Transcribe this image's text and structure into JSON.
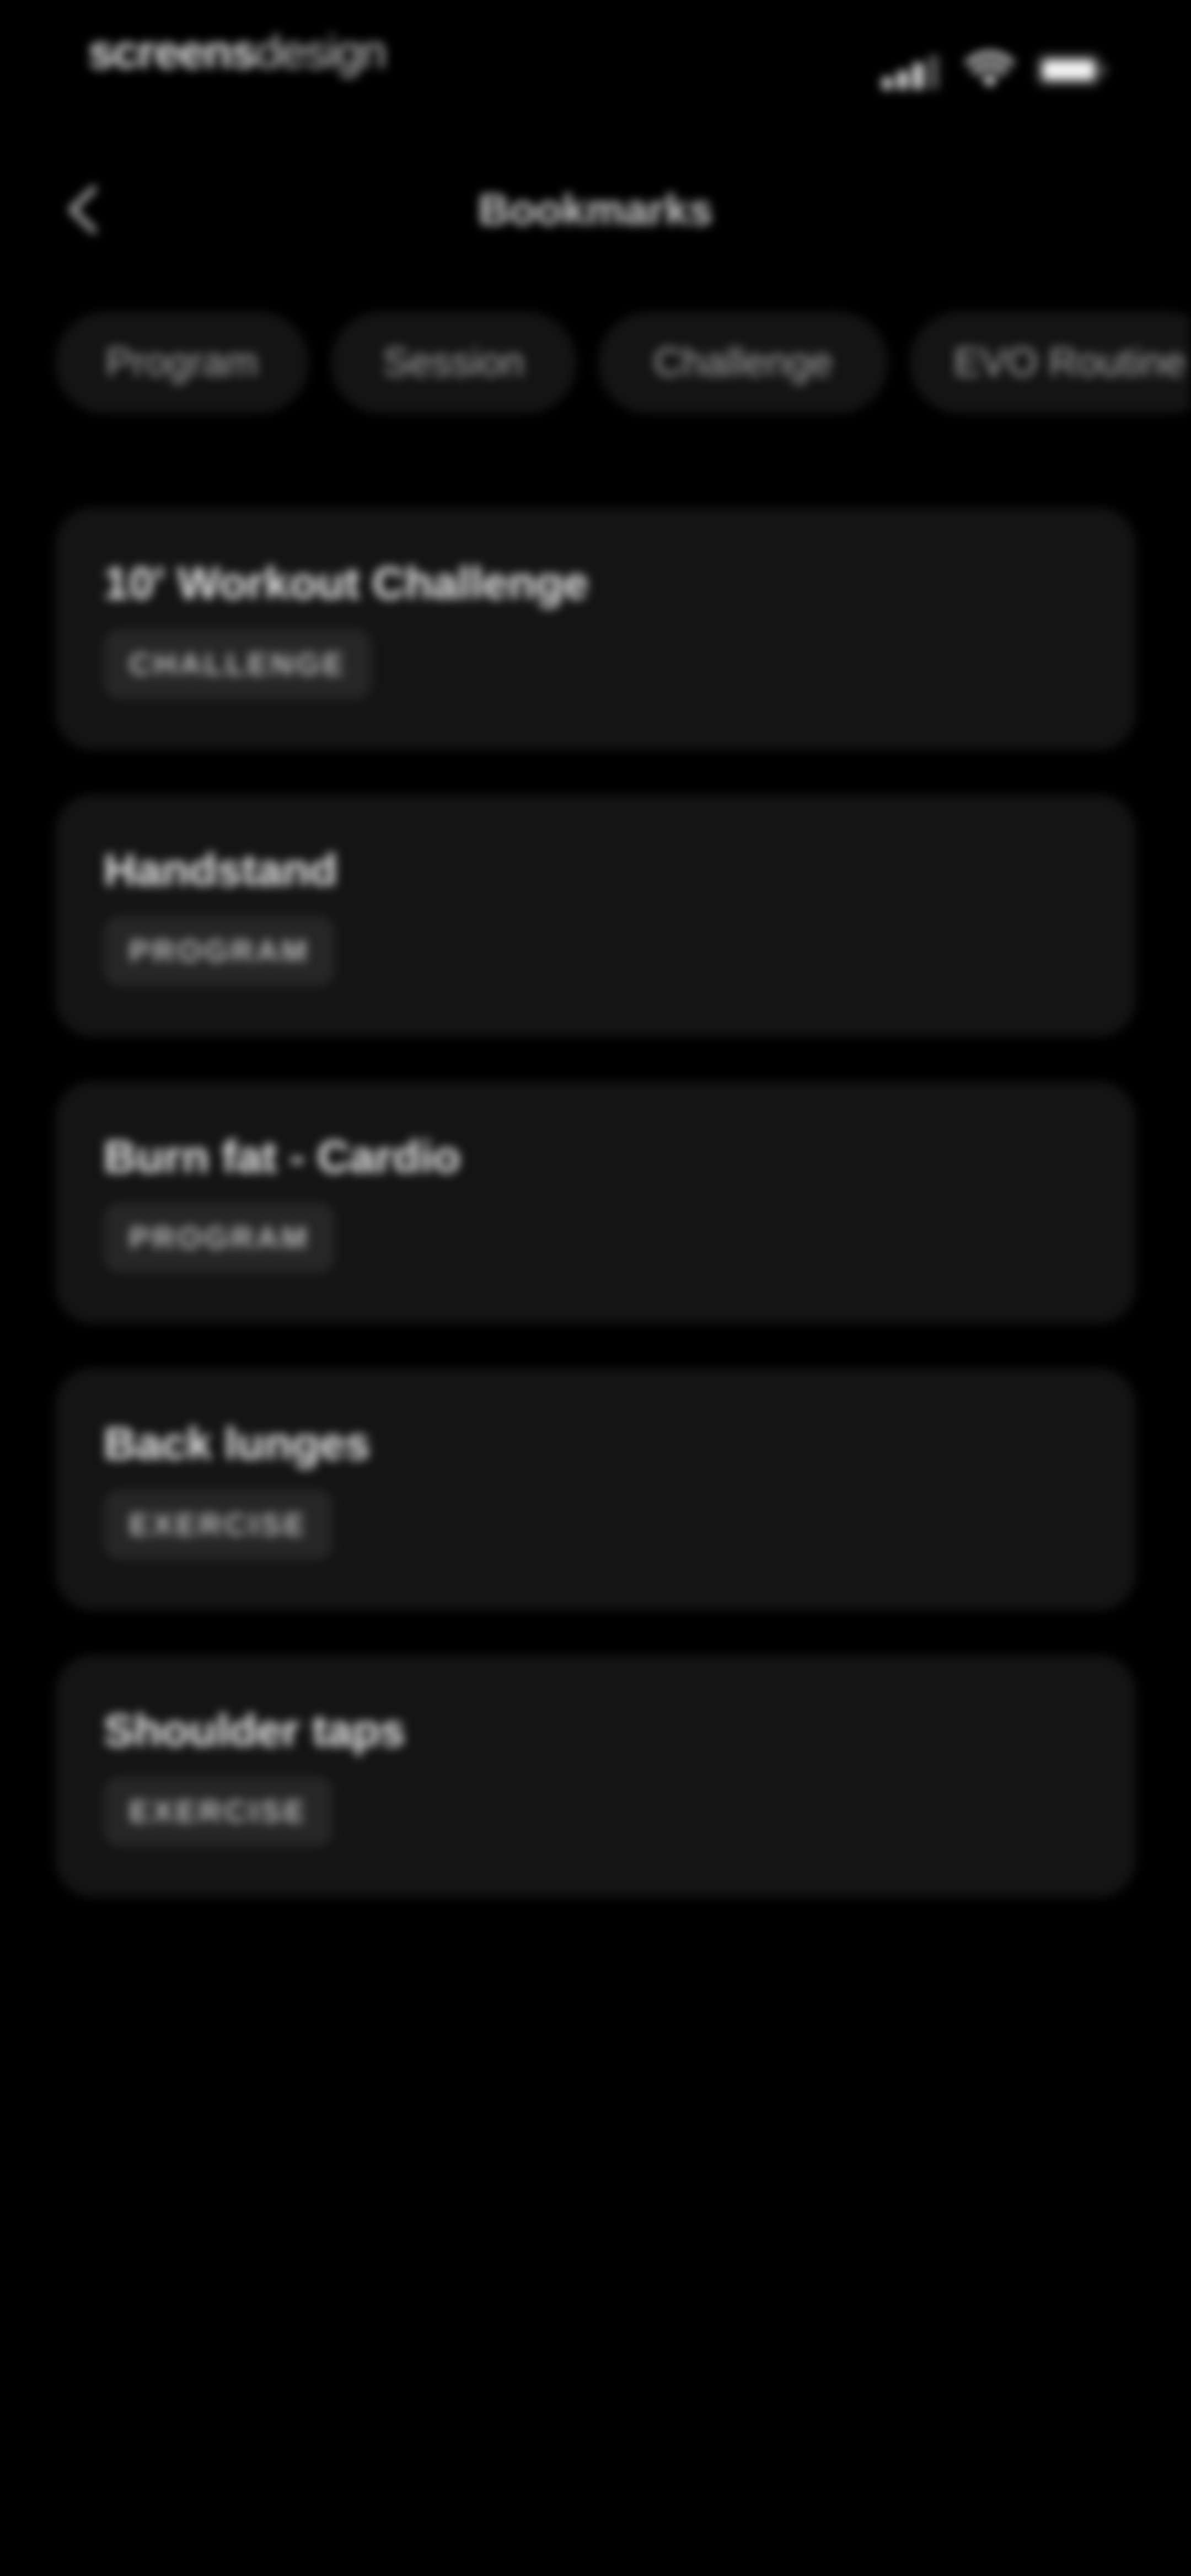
{
  "status_bar": {
    "brand_bold": "screens",
    "brand_light": "design"
  },
  "header": {
    "title": "Bookmarks",
    "back_icon": "chevron-left-icon"
  },
  "filters": [
    {
      "label": "Program"
    },
    {
      "label": "Session"
    },
    {
      "label": "Challenge"
    },
    {
      "label": "EVO Routine"
    }
  ],
  "bookmarks": [
    {
      "title": "10' Workout Challenge",
      "tag": "CHALLENGE"
    },
    {
      "title": "Handstand",
      "tag": "PROGRAM"
    },
    {
      "title": "Burn fat - Cardio",
      "tag": "PROGRAM"
    },
    {
      "title": "Back lunges",
      "tag": "EXERCISE"
    },
    {
      "title": "Shoulder taps",
      "tag": "EXERCISE"
    }
  ],
  "colors": {
    "background": "#000000",
    "card": "#141414",
    "tag_bg": "#262626",
    "text_primary": "#ededed",
    "text_secondary": "#a9a9a9"
  }
}
